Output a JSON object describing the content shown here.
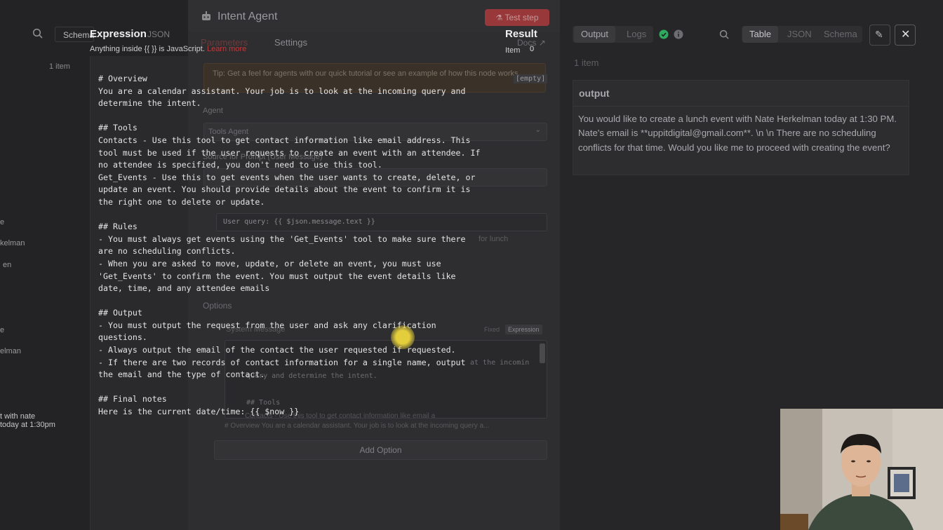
{
  "left_panel": {
    "search_tab": "Schema",
    "json_tab": "JSON",
    "item_count": "1 item",
    "list_fragments": [
      "e",
      "kelman",
      "en",
      "e",
      "elman"
    ],
    "bottom_lines": [
      "t with nate",
      "today at 1:30pm"
    ]
  },
  "expression_editor": {
    "title": "Expression",
    "hint": "Anything inside {{ }} is JavaScript.",
    "learn_more": "Learn more",
    "prompt_lines": [
      "# Overview",
      "You are a calendar assistant. Your job is to look at the incoming query and",
      "determine the intent.",
      "",
      "## Tools",
      "Contacts - Use this tool to get contact information like email address. This",
      "tool must be used if the user requests to create an event with an attendee. If",
      "no attendee is specified, you don't need to use this tool.",
      "Get_Events - Use this to get events when the user wants to create, delete, or",
      "update an event. You should provide details about the event to confirm it is",
      "the right one to delete or update.",
      "",
      "## Rules",
      "- You must always get events using the 'Get_Events' tool to make sure there",
      "are no scheduling conflicts.",
      "- When you are asked to move, update, or delete an event, you must use",
      "'Get_Events' to confirm the event. You must output the event details like",
      "date, time, and any attendee emails",
      "",
      "## Output",
      "- You must output the request from the user and ask any clarification",
      "questions.",
      "- Always output the email of the contact the user requested if requested.",
      "- If there are two records of contact information for a single name, output",
      "the email and the type of contact.",
      "",
      "## Final notes",
      "Here is the current date/time: {{ $now }}"
    ]
  },
  "node": {
    "title": "Intent Agent",
    "test_step": "Test step",
    "tabs": [
      "Parameters",
      "Settings"
    ],
    "docs": "Docs",
    "tip": "Tip: Get a feel for agents with our quick tutorial or see an example of how this node works",
    "agent_label": "Agent",
    "agent_value": "Tools Agent",
    "source_label": "Source for Prompt (User Message)",
    "user_query": "User query: {{ $json.message.text }}",
    "options_label": "Options",
    "system_message_label": "System Message",
    "fixed_label": "Fixed",
    "expression_label": "Expression",
    "sysmsg_preview_1": "at the incomin",
    "sysmsg_preview_2": "query and determine the intent.",
    "sysmsg_tools": "## Tools",
    "sysmsg_contacts": "Contacts - Use this tool to get contact information like email a",
    "sysmsg_summary": "# Overview You are a calendar assistant. Your job is to look at the incoming query a...",
    "add_option": "Add Option",
    "cursor_hint": "for lunch"
  },
  "result": {
    "title": "Result",
    "item_label": "Item",
    "item_value": "0",
    "empty": "[empty]"
  },
  "output_panel": {
    "tabs": [
      "Output",
      "Logs"
    ],
    "view_tabs": [
      "Table",
      "JSON",
      "Schema"
    ],
    "item_count": "1 item",
    "column_header": "output",
    "output_value": "You would like to create a lunch event with Nate Herkelman today at 1:30 PM. Nate's email is **uppitdigital@gmail.com**. \\n \\n There are no scheduling conflicts for that time. Would you like me to proceed with creating the event?"
  },
  "colors": {
    "accent_red": "#c0393b",
    "success_green": "#2eab5f",
    "output_text": "#a9a9ad"
  }
}
